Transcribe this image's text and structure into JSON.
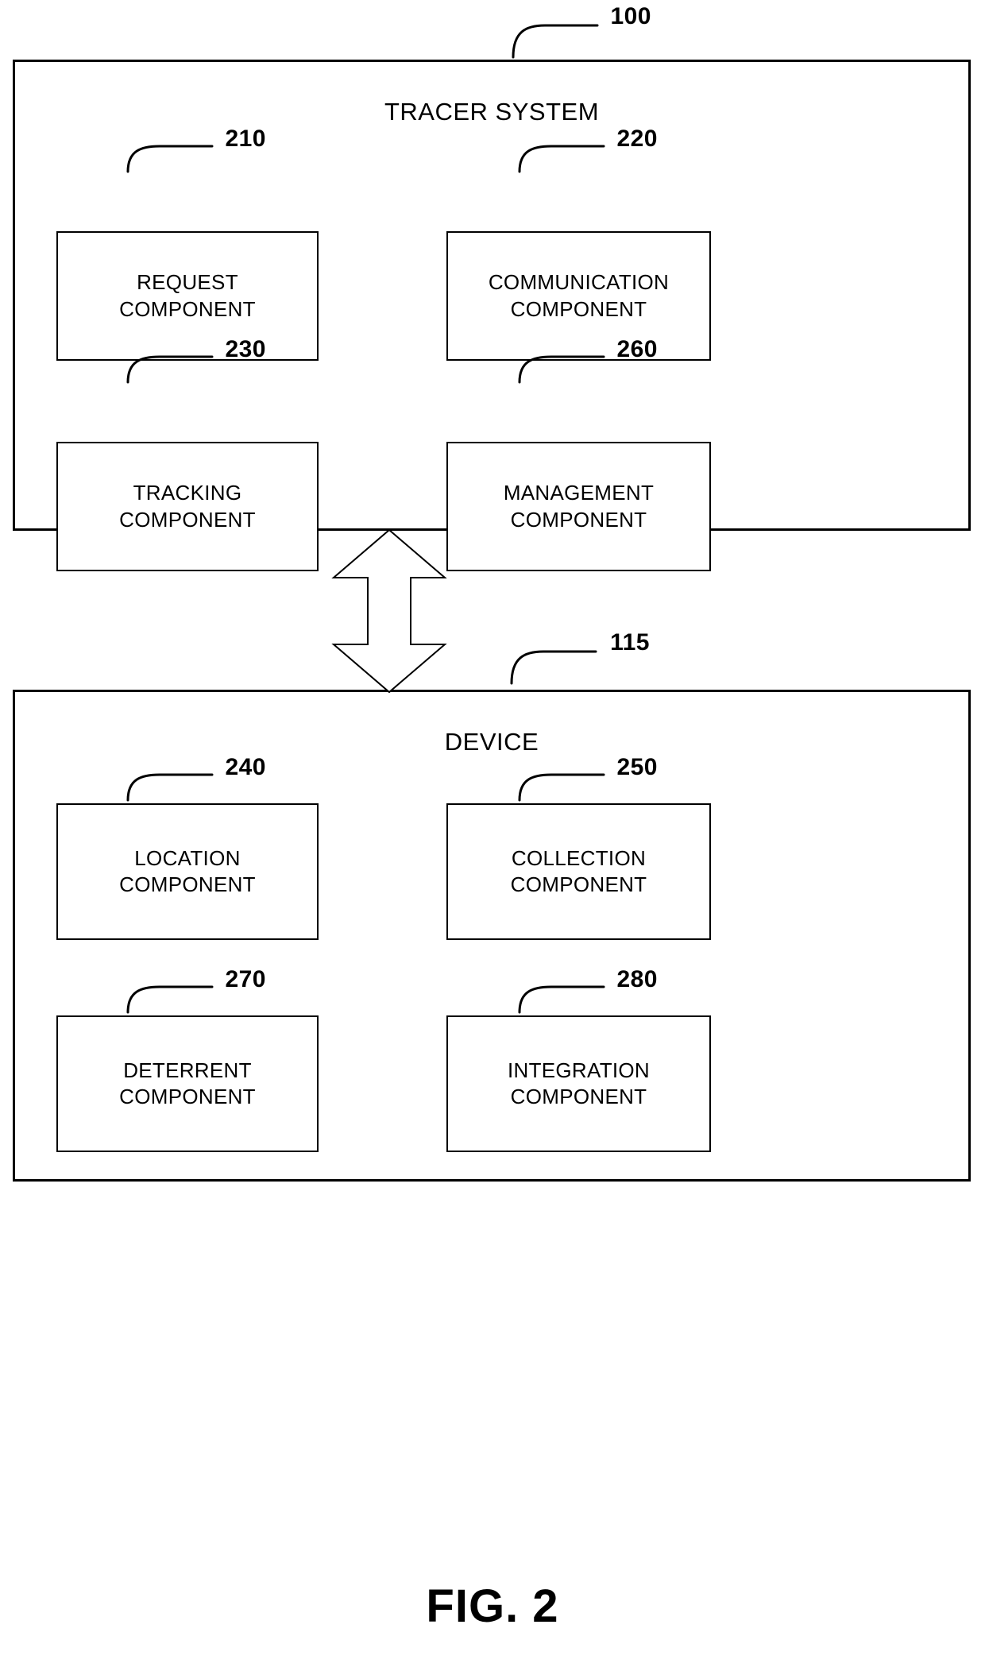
{
  "figure": {
    "caption": "FIG. 2"
  },
  "tracer_system": {
    "ref": "100",
    "title": "TRACER SYSTEM",
    "components": [
      {
        "ref": "210",
        "label": "REQUEST\nCOMPONENT"
      },
      {
        "ref": "220",
        "label": "COMMUNICATION\nCOMPONENT"
      },
      {
        "ref": "230",
        "label": "TRACKING\nCOMPONENT"
      },
      {
        "ref": "260",
        "label": "MANAGEMENT\nCOMPONENT"
      }
    ]
  },
  "device": {
    "ref": "115",
    "title": "DEVICE",
    "components": [
      {
        "ref": "240",
        "label": "LOCATION\nCOMPONENT"
      },
      {
        "ref": "250",
        "label": "COLLECTION\nCOMPONENT"
      },
      {
        "ref": "270",
        "label": "DETERRENT\nCOMPONENT"
      },
      {
        "ref": "280",
        "label": "INTEGRATION\nCOMPONENT"
      }
    ]
  },
  "connector": {
    "name": "bidirectional-arrow",
    "direction": "both"
  },
  "colors": {
    "line": "#000000",
    "background": "#ffffff"
  }
}
